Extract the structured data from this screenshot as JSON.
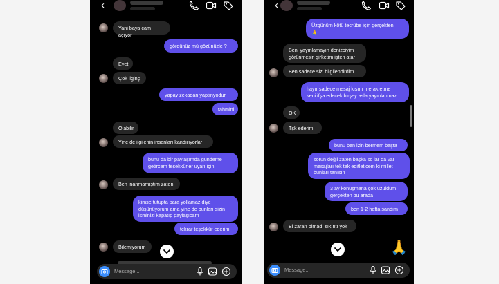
{
  "left_chat": {
    "messages": [
      {
        "dir": "received",
        "text": "Yani baya cam açıyor"
      },
      {
        "dir": "sent",
        "text": "gördünüz mü gözünüzle ?"
      },
      {
        "dir": "received",
        "text": "Evet"
      },
      {
        "dir": "received",
        "text": "Çok ilginç"
      },
      {
        "dir": "sent",
        "text": "yapay zekadan yaptınyodur"
      },
      {
        "dir": "sent",
        "text": "tahmini"
      },
      {
        "dir": "received",
        "text": "Olabilir"
      },
      {
        "dir": "received",
        "text": "Yine de ilgilenin insanları kandırıyorlar"
      },
      {
        "dir": "sent",
        "text": "bunu da bir paylaşımda gündeme\ngetircem teşekkürler uyarı için"
      },
      {
        "dir": "received",
        "text": "Ben inanmamıştım zaten"
      },
      {
        "dir": "sent",
        "text": "kimse tutupta para yollamaz diye\ndüşünüyorum ama yine de bunları sizin\nisminizi kapatıp paylaşıcam"
      },
      {
        "dir": "sent",
        "text": "tekrar teşekkür ederim"
      },
      {
        "dir": "received",
        "text": "Bilemiyorum"
      }
    ],
    "input_placeholder": "Message..."
  },
  "right_chat": {
    "messages": [
      {
        "dir": "sent",
        "text": "Üzgünüm kötü tecrübe için gerçekten\n🙏"
      },
      {
        "dir": "received",
        "text": "Beni yayınlamayın denizciyim\ngörünmesin şirketim işten atar"
      },
      {
        "dir": "received",
        "text": "Ben sadece sizi bilgilendirdim"
      },
      {
        "dir": "sent",
        "text": "hayır sadece mesaj kısmı merak etme\nseni ifşa edecek birşey asla yayınlanmaz"
      },
      {
        "dir": "received",
        "text": "OK"
      },
      {
        "dir": "received",
        "text": "Tşk ederim"
      },
      {
        "dir": "sent",
        "text": "bunu ben izin bermem başta"
      },
      {
        "dir": "sent",
        "text": "sorun değil zaten başka sc lar da var\nmesajları tek tek editleticem ki millet\nbunları tanısın"
      },
      {
        "dir": "sent",
        "text": "3 ay konuşmana çok üzüldüm\ngerçekten bu arada"
      },
      {
        "dir": "sent",
        "text": "ben 1-2 hafta sandım"
      },
      {
        "dir": "received",
        "text": "Bi zararı olmadı sıkıntı yok"
      }
    ],
    "emoji": "🙏",
    "input_placeholder": "Message..."
  },
  "icons": {
    "back": "chevron-left-icon",
    "call": "phone-icon",
    "video": "video-icon",
    "tag": "tag-icon",
    "camera": "camera-icon",
    "mic": "microphone-icon",
    "gallery": "image-icon",
    "add": "plus-circle-icon",
    "scroll": "chevron-down-icon"
  },
  "colors": {
    "background": "#000000",
    "sent_bubble": "#5f50ea",
    "received_bubble": "#262626",
    "camera_button": "#3a8dfc"
  }
}
